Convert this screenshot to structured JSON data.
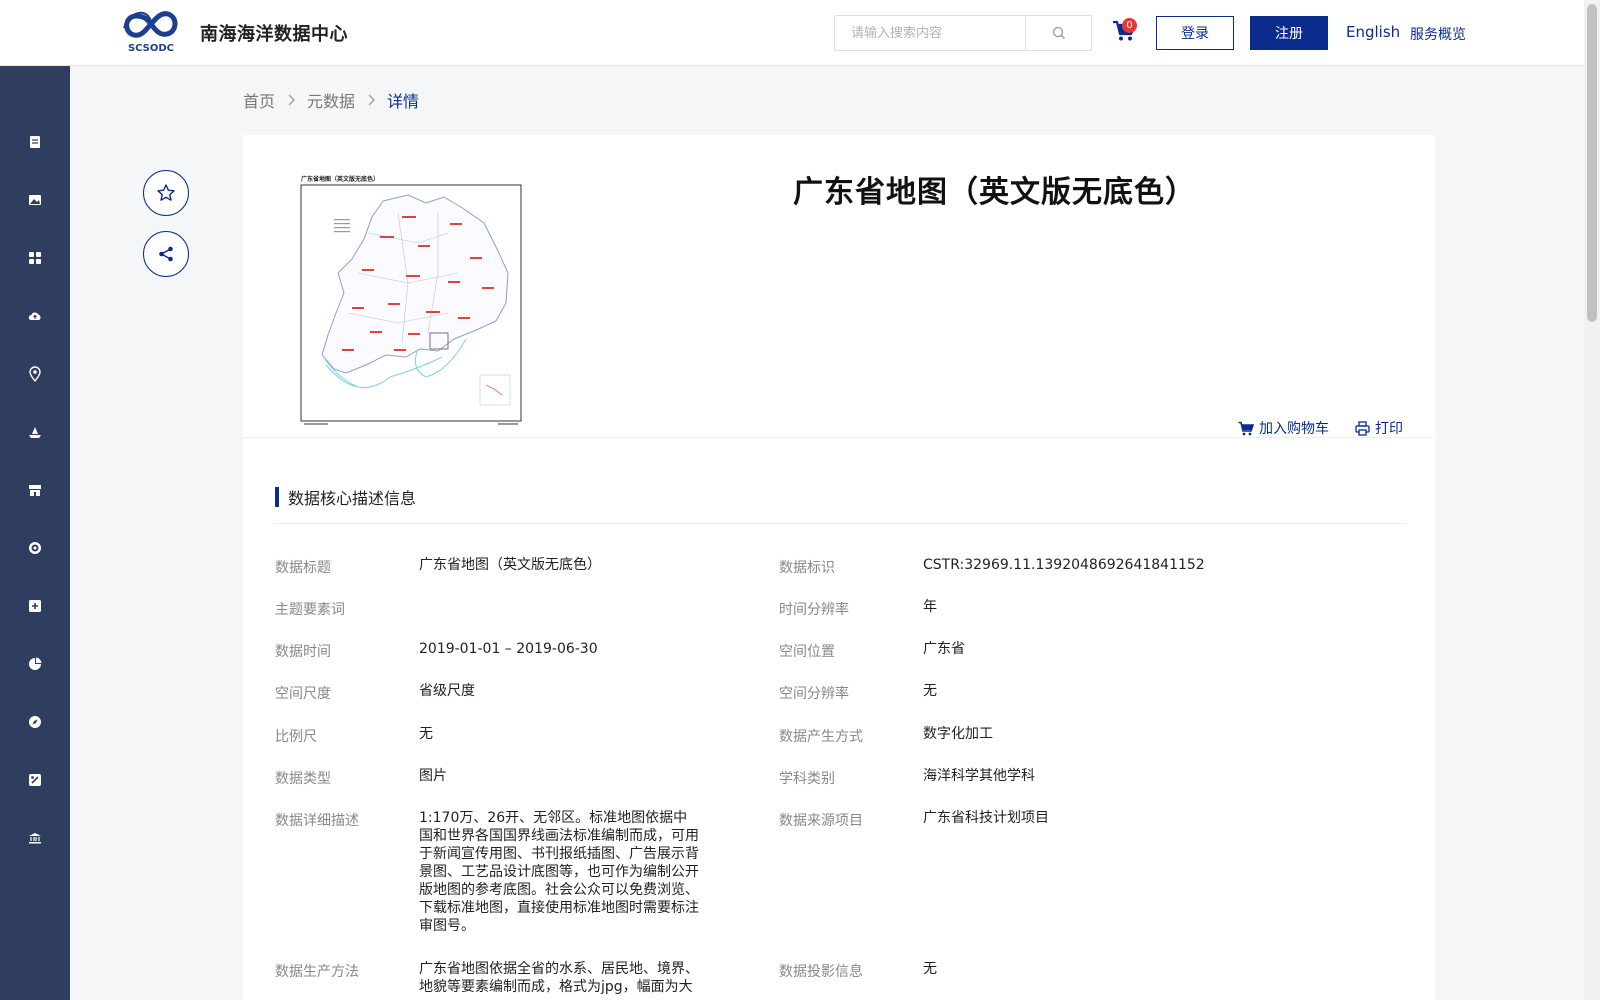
{
  "header": {
    "site_name": "南海海洋数据中心",
    "logo_text": "SCSODC",
    "search_placeholder": "请输入搜索内容",
    "cart_count": "0",
    "login_label": "登录",
    "register_label": "注册",
    "english_label": "English",
    "services_label": "服务概览"
  },
  "sidebar": {
    "icons": [
      "document-icon",
      "image-icon",
      "grid-icon",
      "cloud-upload-icon",
      "location-pin-icon",
      "ship-icon",
      "storefront-icon",
      "target-icon",
      "plus-box-icon",
      "pie-chart-icon",
      "compass-icon",
      "tools-icon",
      "institution-icon"
    ]
  },
  "breadcrumb": {
    "items": [
      "首页",
      "元数据",
      "详情"
    ]
  },
  "detail": {
    "title": "广东省地图（英文版无底色）",
    "thumbnail_caption": "广东省地图（英文版无底色）",
    "add_to_cart_label": "加入购物车",
    "print_label": "打印",
    "section_title": "数据核心描述信息",
    "fields": {
      "title": {
        "label": "数据标题",
        "value": "广东省地图（英文版无底色）"
      },
      "identifier": {
        "label": "数据标识",
        "value": "CSTR:32969.11.1392048692641841152"
      },
      "keywords": {
        "label": "主题要素词",
        "value": ""
      },
      "time_resolution": {
        "label": "时间分辨率",
        "value": "年"
      },
      "data_time": {
        "label": "数据时间",
        "value": "2019-01-01 – 2019-06-30"
      },
      "spatial_location": {
        "label": "空间位置",
        "value": "广东省"
      },
      "spatial_scale": {
        "label": "空间尺度",
        "value": "省级尺度"
      },
      "spatial_resolution": {
        "label": "空间分辨率",
        "value": "无"
      },
      "map_scale": {
        "label": "比例尺",
        "value": "无"
      },
      "generation_method": {
        "label": "数据产生方式",
        "value": "数字化加工"
      },
      "data_type": {
        "label": "数据类型",
        "value": "图片"
      },
      "discipline": {
        "label": "学科类别",
        "value": "海洋科学其他学科"
      },
      "description": {
        "label": "数据详细描述",
        "value": "1:170万、26开、无邻区。标准地图依据中国和世界各国国界线画法标准编制而成，可用于新闻宣传用图、书刊报纸插图、广告展示背景图、工艺品设计底图等，也可作为编制公开版地图的参考底图。社会公众可以免费浏览、下载标准地图，直接使用标准地图时需要标注审图号。"
      },
      "source_project": {
        "label": "数据来源项目",
        "value": "广东省科技计划项目"
      },
      "production_method": {
        "label": "数据生产方法",
        "value": "广东省地图依据全省的水系、居民地、境界、地貌等要素编制而成，格式为jpg，幅面为大"
      },
      "projection": {
        "label": "数据投影信息",
        "value": "无"
      }
    }
  },
  "colors": {
    "brand": "#0b2c8c",
    "sidebar_bg": "#2f3d5e",
    "badge": "#e53935"
  }
}
